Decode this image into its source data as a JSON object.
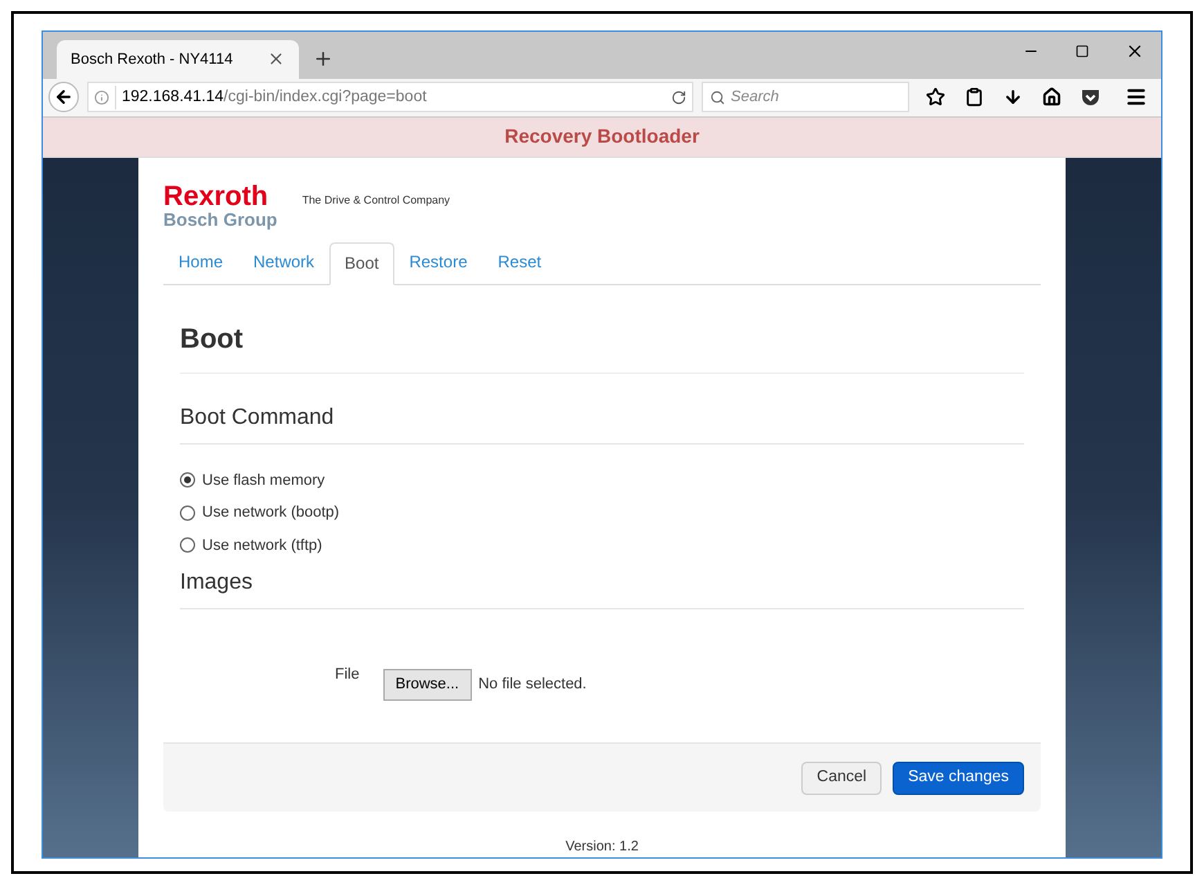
{
  "browser": {
    "tab_title": "Bosch Rexoth - NY4114",
    "url_host": "192.168.41.14",
    "url_path": "/cgi-bin/index.cgi?page=boot",
    "search_placeholder": "Search"
  },
  "banner": "Recovery Bootloader",
  "logo": {
    "brand": "Rexroth",
    "group": "Bosch Group",
    "tagline": "The Drive & Control Company"
  },
  "tabs": [
    {
      "label": "Home",
      "selected": false
    },
    {
      "label": "Network",
      "selected": false
    },
    {
      "label": "Boot",
      "selected": true
    },
    {
      "label": "Restore",
      "selected": false
    },
    {
      "label": "Reset",
      "selected": false
    }
  ],
  "page_title": "Boot",
  "boot_command": {
    "heading": "Boot Command",
    "options": [
      {
        "label": "Use flash memory",
        "selected": true
      },
      {
        "label": "Use network (bootp)",
        "selected": false
      },
      {
        "label": "Use network (tftp)",
        "selected": false
      }
    ]
  },
  "images": {
    "heading": "Images",
    "file_label": "File",
    "browse_button": "Browse...",
    "file_status": "No file selected."
  },
  "buttons": {
    "cancel": "Cancel",
    "save": "Save changes"
  },
  "version": "Version: 1.2"
}
